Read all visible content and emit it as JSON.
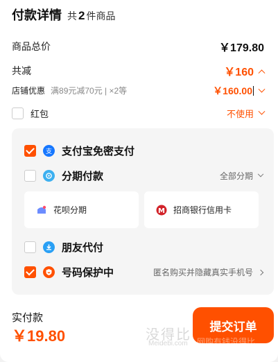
{
  "header": {
    "title": "付款详情",
    "count_prefix": "共",
    "count": "2",
    "count_suffix": "件商品"
  },
  "summary": {
    "total_label": "商品总价",
    "total_value": "￥179.80",
    "reduce_label": "共减",
    "reduce_value": "￥160",
    "shop_label": "店铺优惠",
    "shop_desc": "满89元减70元 | ×2等",
    "shop_value": "￥160.00",
    "redpacket_label": "红包",
    "redpacket_value": "不使用"
  },
  "payment": {
    "alipay_label": "支付宝免密支付",
    "installment_label": "分期付款",
    "installment_right": "全部分期",
    "huabei_label": "花呗分期",
    "cmb_label": "招商银行信用卡",
    "friend_label": "朋友代付",
    "privacy_label": "号码保护中",
    "privacy_right": "匿名购买并隐藏真实手机号"
  },
  "footer": {
    "paid_label": "实付款",
    "paid_value": "￥19.80",
    "submit_label": "提交订单"
  },
  "watermark": {
    "line1": "没得比",
    "line2": "Meidebi.com",
    "line3": "网购有钱没得比"
  },
  "colors": {
    "accent": "#ff5000",
    "alipay": "#1677ff",
    "friend": "#2aa0f5",
    "cmb": "#d2232a"
  },
  "icons": {
    "alipay": "alipay-icon",
    "installment": "installment-icon",
    "huabei": "huabei-icon",
    "cmb": "cmb-icon",
    "friend": "friend-pay-icon",
    "privacy": "shield-icon"
  }
}
